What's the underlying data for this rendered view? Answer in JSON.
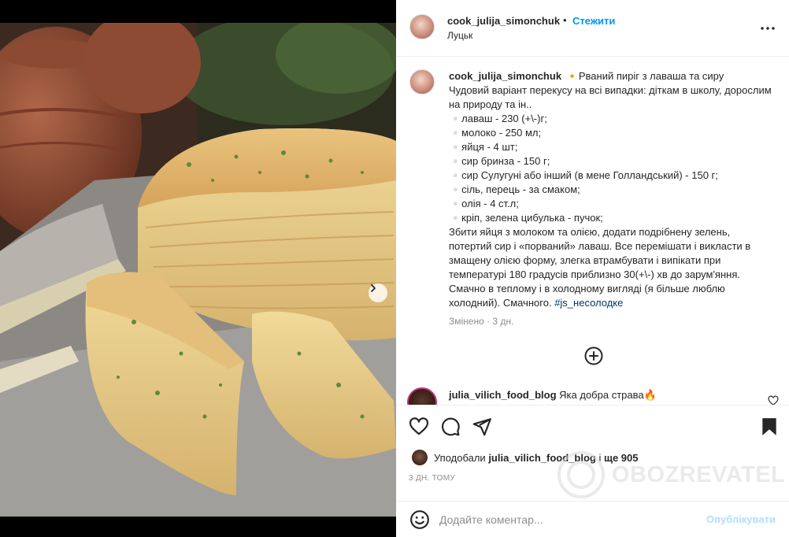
{
  "photo": {
    "description_icon": "food-photo",
    "carousel": {
      "total": 5,
      "active": 1
    }
  },
  "header": {
    "username": "cook_julija_simonchuk",
    "separator": "•",
    "follow_label": "Стежити",
    "location": "Луцьк",
    "more_icon": "more-options-icon"
  },
  "caption": {
    "username": "cook_julija_simonchuk",
    "text": "🔸Рваний пиріг з лаваша та сиру\nЧудовий варіант перекусу на всі випадки: діткам в школу, дорослим на природу та ін..\n▫️лаваш - 230 (+\\-)г;\n▫️молоко - 250 мл;\n▫️яйця - 4 шт;\n▫️сир бринза - 150 г;\n▫️сир Сулугуні або інший (в мене Голландський) - 150 г;\n▫️сіль, перець - за смаком;\n▫️олія - 4 ст.л;\n▫️кріп, зелена цибулька - пучок;\nЗбити яйця з молоком та олією, додати подрібнену зелень, потертий сир і «порваний» лаваш. Все перемішати і викласти в змащену олією форму, злегка втрамбувати і випікати при температурі 180 градусів приблизно 30(+\\-) хв до зарум'яння. Смачно в теплому і в холодному вигляді (я більше люблю холодний). Смачного. ",
    "hashtag": "#js_несолодке",
    "edited": "Змінено · 3 дн."
  },
  "comment": {
    "username": "julia_vilich_food_blog",
    "text": "Яка добра страва🔥"
  },
  "actions": {
    "like_icon": "heart-icon",
    "comment_icon": "comment-icon",
    "share_icon": "send-icon",
    "save_icon": "bookmark-icon"
  },
  "likes": {
    "prefix": "Уподобали ",
    "user": "julia_vilich_food_blog",
    "middle": " і ",
    "others": "ще 905"
  },
  "time": "3 ДН. ТОМУ",
  "watermark": "OBOZREVATEL",
  "add_comment": {
    "placeholder": "Додайте коментар...",
    "publish_label": "Опублікувати"
  },
  "colors": {
    "accent": "#0095f6",
    "publish_disabled": "#b2dffc",
    "text": "#262626",
    "muted": "#8e8e8e",
    "hashtag": "#00376b"
  }
}
